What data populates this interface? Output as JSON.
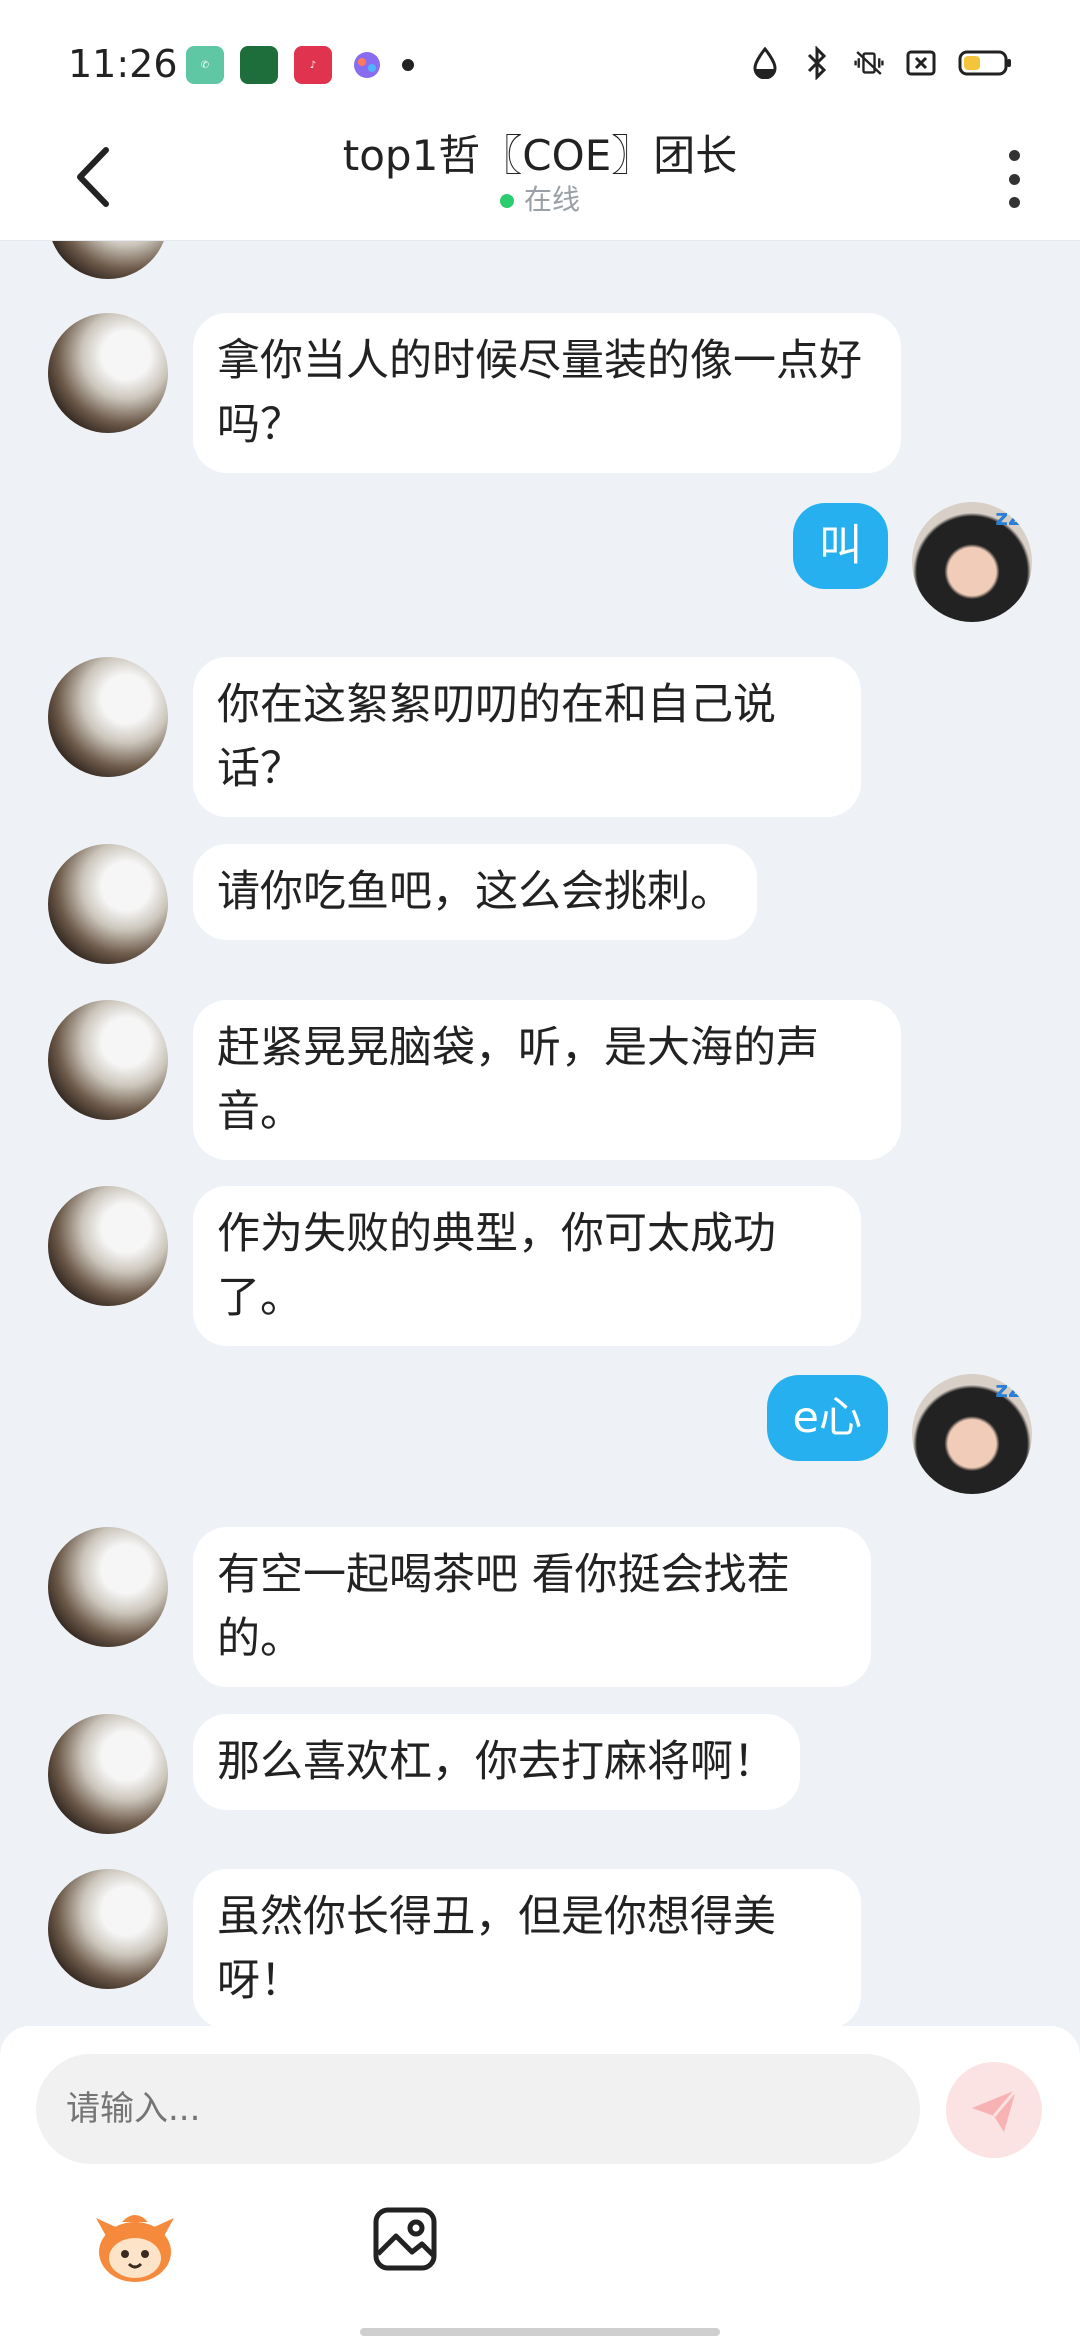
{
  "status_bar": {
    "time": "11:26"
  },
  "header": {
    "title": "top1哲〖COE〗团长",
    "status": "在线"
  },
  "messages": [
    {
      "from": "them",
      "text": "拿你当人的时候尽量装的像一点好吗？"
    },
    {
      "from": "me",
      "text": "叫"
    },
    {
      "from": "them",
      "text": "你在这絮絮叨叨的在和自己说话？"
    },
    {
      "from": "them",
      "text": "请你吃鱼吧，这么会挑刺。"
    },
    {
      "from": "them",
      "text": "赶紧晃晃脑袋，听，是大海的声音。"
    },
    {
      "from": "them",
      "text": "作为失败的典型，你可太成功了。"
    },
    {
      "from": "me",
      "text": "e心"
    },
    {
      "from": "them",
      "text": "有空一起喝茶吧 看你挺会找茬的。"
    },
    {
      "from": "them",
      "text": "那么喜欢杠，你去打麻将啊！"
    },
    {
      "from": "them",
      "text": "虽然你长得丑，但是你想得美呀！"
    }
  ],
  "input": {
    "placeholder": "请输入..."
  },
  "colors": {
    "accent": "#27b0f0",
    "online": "#2ecc71",
    "background": "#eef2f6"
  }
}
